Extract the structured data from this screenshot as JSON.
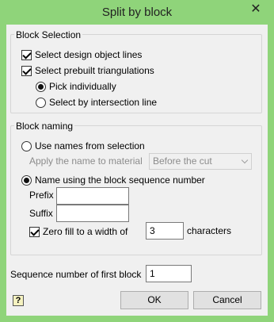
{
  "window": {
    "title": "Split by block",
    "close_glyph": "✕"
  },
  "block_selection": {
    "label": "Block Selection",
    "select_design_lines": {
      "label": "Select design object lines",
      "checked": true
    },
    "select_prebuilt": {
      "label": "Select prebuilt triangulations",
      "checked": true
    },
    "pick_individually": {
      "label": "Pick individually",
      "selected": true
    },
    "select_by_line": {
      "label": "Select by intersection line",
      "selected": false
    }
  },
  "block_naming": {
    "label": "Block naming",
    "use_names": {
      "label": "Use names from selection",
      "selected": false
    },
    "apply_name_label": "Apply the name to material",
    "apply_name_value": "Before the cut",
    "name_sequence": {
      "label": "Name using the block sequence number",
      "selected": true
    },
    "prefix_label": "Prefix",
    "prefix_value": "",
    "suffix_label": "Suffix",
    "suffix_value": "",
    "zero_fill": {
      "label": "Zero fill to a width of",
      "checked": true
    },
    "zero_fill_width": "3",
    "characters_label": "characters"
  },
  "sequence": {
    "label": "Sequence number of first block",
    "value": "1"
  },
  "buttons": {
    "ok": "OK",
    "cancel": "Cancel"
  },
  "help_icon": {
    "glyph": "?",
    "icon": "help-icon"
  }
}
